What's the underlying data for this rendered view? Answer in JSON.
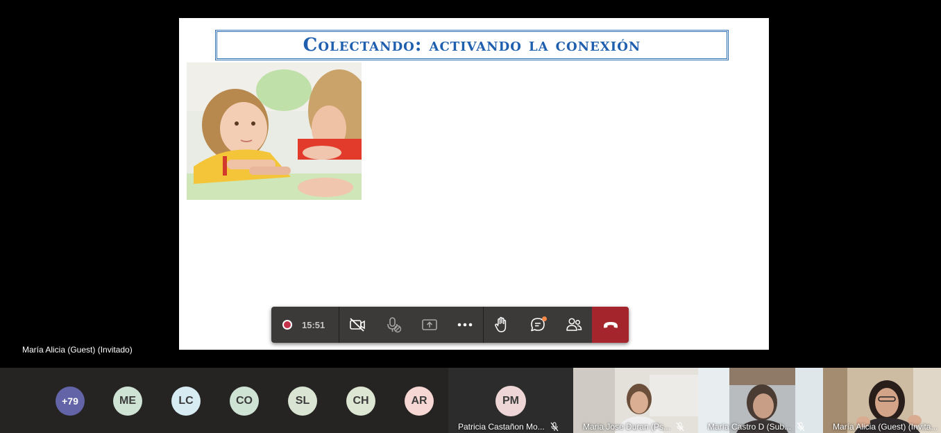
{
  "slide": {
    "title": "Colectando: activando la conexión",
    "presenter": "María Alicia (Guest) (Invitado)"
  },
  "controls": {
    "timer": "15:51"
  },
  "participants": {
    "more_count": "+79",
    "avatars": [
      {
        "initials": "ME",
        "color": "#cfe3d4"
      },
      {
        "initials": "LC",
        "color": "#d6ebf2"
      },
      {
        "initials": "CO",
        "color": "#cfe3d4"
      },
      {
        "initials": "SL",
        "color": "#d9e4d2"
      },
      {
        "initials": "CH",
        "color": "#dde6d3"
      },
      {
        "initials": "AR",
        "color": "#f6d7d4"
      }
    ],
    "tiles": [
      {
        "initials": "PM",
        "name": "Patricia Castañon Mo..."
      },
      {
        "name": "Maria Jose Duran (Ps..."
      },
      {
        "name": "María Castro D (Sub..."
      },
      {
        "name": "María Alicia (Guest) (Invita..."
      }
    ]
  }
}
